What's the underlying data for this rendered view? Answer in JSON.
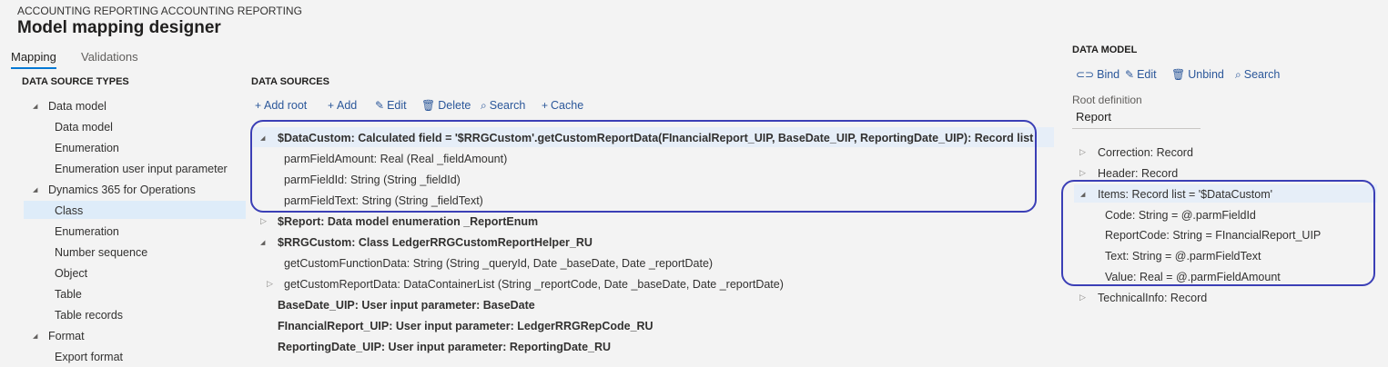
{
  "header": {
    "breadcrumb": "ACCOUNTING REPORTING ACCOUNTING REPORTING",
    "title": "Model mapping designer"
  },
  "tabs": [
    {
      "label": "Mapping",
      "active": true
    },
    {
      "label": "Validations",
      "active": false
    }
  ],
  "data_source_types": {
    "heading": "DATA SOURCE TYPES",
    "items": [
      {
        "label": "Data model",
        "group": true
      },
      {
        "label": "Data model"
      },
      {
        "label": "Enumeration"
      },
      {
        "label": "Enumeration user input parameter"
      },
      {
        "label": "Dynamics 365 for Operations",
        "group": true
      },
      {
        "label": "Class",
        "selected": true
      },
      {
        "label": "Enumeration"
      },
      {
        "label": "Number sequence"
      },
      {
        "label": "Object"
      },
      {
        "label": "Table"
      },
      {
        "label": "Table records"
      },
      {
        "label": "Format",
        "group": true
      },
      {
        "label": "Export format"
      }
    ]
  },
  "data_sources": {
    "heading": "DATA SOURCES",
    "toolbar": {
      "add_root": "Add root",
      "add": "Add",
      "edit": "Edit",
      "delete": "Delete",
      "search": "Search",
      "cache": "Cache"
    },
    "tree": [
      {
        "label": "$DataCustom: Calculated field = '$RRGCustom'.getCustomReportData(FInancialReport_UIP, BaseDate_UIP, ReportingDate_UIP): Record list",
        "bold": true
      },
      {
        "label": "parmFieldAmount: Real (Real _fieldAmount)"
      },
      {
        "label": "parmFieldId: String (String _fieldId)"
      },
      {
        "label": "parmFieldText: String (String _fieldText)"
      },
      {
        "label": "$Report: Data model enumeration _ReportEnum",
        "bold": true
      },
      {
        "label": "$RRGCustom: Class LedgerRRGCustomReportHelper_RU",
        "bold": true
      },
      {
        "label": "getCustomFunctionData: String (String _queryId, Date _baseDate, Date _reportDate)"
      },
      {
        "label": "getCustomReportData: DataContainerList (String _reportCode, Date _baseDate, Date _reportDate)"
      },
      {
        "label": "BaseDate_UIP: User input parameter: BaseDate",
        "bold": true
      },
      {
        "label": "FInancialReport_UIP: User input parameter: LedgerRRGRepCode_RU",
        "bold": true
      },
      {
        "label": "ReportingDate_UIP: User input parameter: ReportingDate_RU",
        "bold": true
      }
    ]
  },
  "data_model": {
    "heading": "DATA MODEL",
    "toolbar": {
      "bind": "Bind",
      "edit": "Edit",
      "unbind": "Unbind",
      "search": "Search"
    },
    "root_definition_label": "Root definition",
    "root_definition_value": "Report",
    "tree": [
      {
        "label": "Correction: Record"
      },
      {
        "label": "Header: Record"
      },
      {
        "label": "Items: Record list = '$DataCustom'",
        "selected": true
      },
      {
        "label": "Code: String = @.parmFieldId"
      },
      {
        "label": "ReportCode: String = FInancialReport_UIP"
      },
      {
        "label": "Text: String = @.parmFieldText"
      },
      {
        "label": "Value: Real = @.parmFieldAmount"
      },
      {
        "label": "TechnicalInfo: Record"
      }
    ]
  },
  "colors": {
    "accent": "#0078d4",
    "highlight_border": "#3b3fb6",
    "selection": "#deecf9",
    "toolbar_text": "#2b579a"
  }
}
